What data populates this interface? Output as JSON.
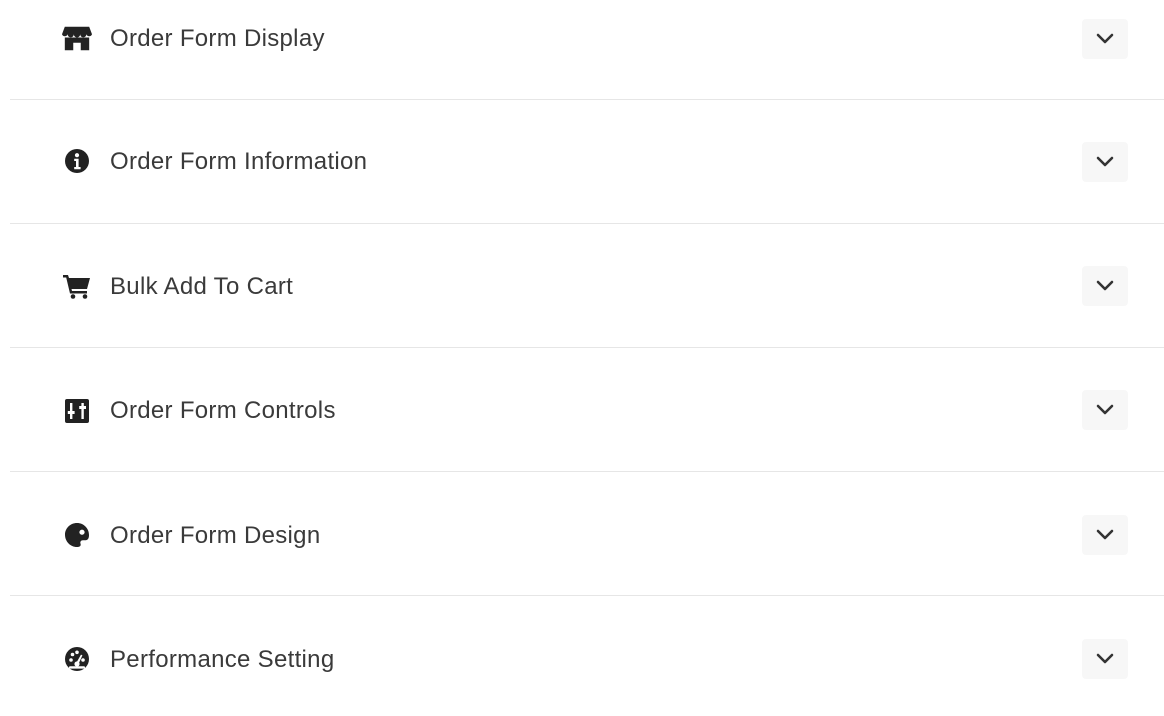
{
  "accordion": {
    "items": [
      {
        "label": "Order Form Display",
        "icon": "store-icon"
      },
      {
        "label": "Order Form Information",
        "icon": "info-circle-icon"
      },
      {
        "label": "Bulk Add To Cart",
        "icon": "cart-icon"
      },
      {
        "label": "Order Form Controls",
        "icon": "sliders-icon"
      },
      {
        "label": "Order Form Design",
        "icon": "palette-icon"
      },
      {
        "label": "Performance Setting",
        "icon": "speedometer-icon"
      }
    ],
    "toggle_icon": "chevron-down-icon"
  },
  "colors": {
    "text": "#3a3a3a",
    "icon": "#222222",
    "divider": "#e6e6e6",
    "toggle_bg": "#f7f7f7"
  }
}
